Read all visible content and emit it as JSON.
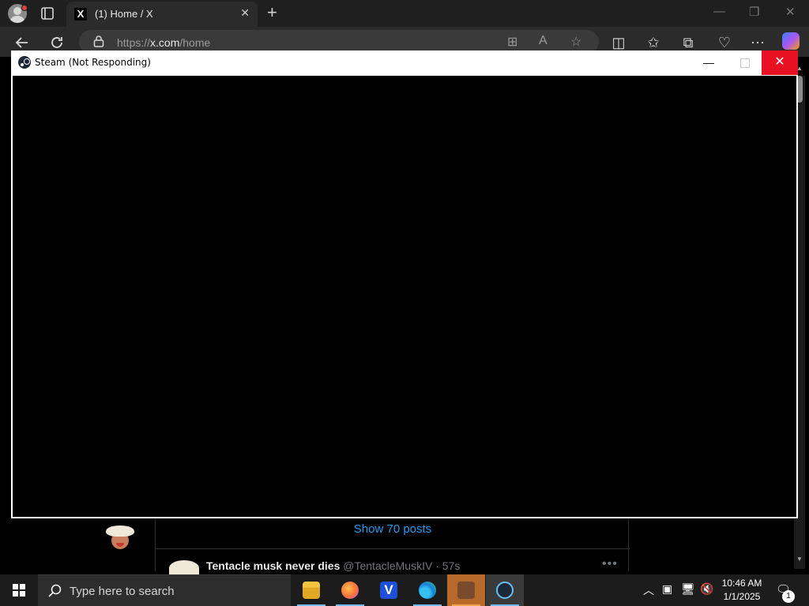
{
  "browser": {
    "tab_title": "(1) Home / X",
    "tab_favicon": "X",
    "url_prefix": "https://",
    "url_domain": "x.com",
    "url_path": "/home",
    "icons": [
      "profile-icon",
      "tab-actions-icon",
      "close-icon",
      "new-tab-icon",
      "back-icon",
      "refresh-icon",
      "lock-icon",
      "apps-icon",
      "read-aloud-icon",
      "favorite-icon",
      "split-screen-icon",
      "favorites-icon",
      "collections-icon",
      "browser-essentials-icon",
      "more-icon",
      "copilot-icon"
    ]
  },
  "page": {
    "show_posts": "Show 70 posts",
    "post": {
      "name": "Tentacle musk never dies",
      "handle": "@TentacleMuskIV",
      "separator": "·",
      "time": "57s"
    }
  },
  "steam_window": {
    "title": "Steam (Not Responding)",
    "close_glyph": "✕",
    "minimize_glyph": "—"
  },
  "taskbar": {
    "search_placeholder": "Type here to search",
    "apps": [
      "file-explorer-icon",
      "firefox-icon",
      "v-app-icon",
      "edge-icon",
      "package-app-icon",
      "steam-icon"
    ],
    "clock_time": "10:46 AM",
    "clock_date": "1/1/2025",
    "notification_count": "1"
  },
  "colors": {
    "accent_link": "#1d9bf0",
    "close_red": "#e81123",
    "taskbar_bg": "#1c1c1c"
  }
}
